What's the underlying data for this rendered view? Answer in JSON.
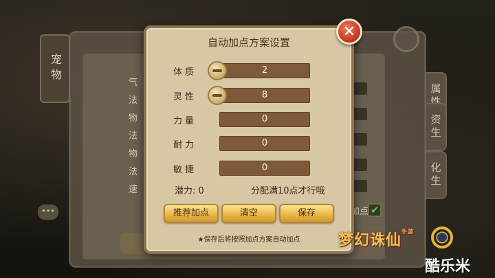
{
  "dialog": {
    "title": "自动加点方案设置",
    "stats": [
      {
        "label": "体质",
        "value": "2",
        "has_minus": true
      },
      {
        "label": "灵性",
        "value": "8",
        "has_minus": true
      },
      {
        "label": "力量",
        "value": "0",
        "has_minus": false
      },
      {
        "label": "耐力",
        "value": "0",
        "has_minus": false
      },
      {
        "label": "敏捷",
        "value": "0",
        "has_minus": false
      }
    ],
    "potential_label": "潜力: 0",
    "rule_text": "分配满10点才行哦",
    "buttons": {
      "recommend": "推荐加点",
      "clear": "清空",
      "save": "保存"
    },
    "hint": "★保存后将按照加点方案自动加点"
  },
  "background": {
    "scroll_label": "宠物",
    "stat_labels": [
      "气",
      "法",
      "物",
      "法",
      "物",
      "法",
      "速"
    ],
    "side_tabs": [
      "属性",
      "资生",
      "化生"
    ],
    "chat_icon": "•••",
    "check_label": "加点",
    "check_mark": "✔"
  },
  "watermark": {
    "game_logo": "梦幻诛仙",
    "game_logo_sub": "手游",
    "site": "酷乐米"
  },
  "colors": {
    "dialog_bg": "#d8c7a4",
    "button_gold": "#e9b84a",
    "stat_bar": "#7e5a3a",
    "close_red": "#c1341e"
  }
}
